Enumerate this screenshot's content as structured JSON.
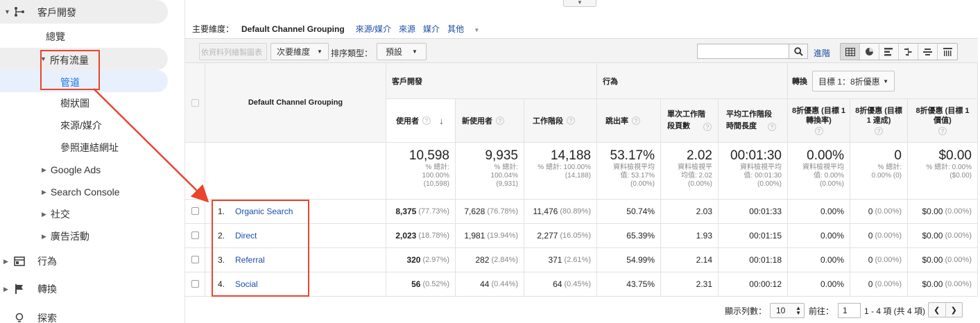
{
  "sidebar": {
    "section_title": "客戶開發",
    "items": [
      {
        "label": "總覽"
      },
      {
        "label": "所有流量"
      },
      {
        "label": "管道"
      },
      {
        "label": "樹狀圖"
      },
      {
        "label": "來源/媒介"
      },
      {
        "label": "參照連結網址"
      },
      {
        "label": "Google Ads"
      },
      {
        "label": "Search Console"
      },
      {
        "label": "社交"
      },
      {
        "label": "廣告活動"
      }
    ],
    "bottom_items": [
      {
        "label": "行為",
        "icon": "behavior-icon"
      },
      {
        "label": "轉換",
        "icon": "flag-icon"
      },
      {
        "label": "探索",
        "icon": "lightbulb-icon"
      }
    ],
    "accent_color": "#1a73e8",
    "selected_bg": "#e8f0fe"
  },
  "dimensions": {
    "label": "主要維度：",
    "active": "Default Channel Grouping",
    "links": [
      "來源/媒介",
      "來源",
      "媒介"
    ],
    "more": "其他"
  },
  "toolbar": {
    "plot_rows": "依資料列繪製圖表",
    "secondary_dim": "次要維度",
    "sort_label": "排序類型：",
    "sort_value": "預設",
    "search_value": "",
    "advanced": "進階"
  },
  "table": {
    "dim_header": "Default Channel Grouping",
    "groups": {
      "acquisition": "客戶開發",
      "behavior": "行為",
      "conversion": "轉換",
      "goal_select": "目標 1：8折優惠"
    },
    "columns": [
      "使用者",
      "新使用者",
      "工作階段",
      "跳出率",
      "單次工作階段頁數",
      "平均工作階段時間長度",
      "8折優惠 (目標 1 轉換率)",
      "8折優惠 (目標 1 達成)",
      "8折優惠 (目標 1 價值)"
    ],
    "totals": [
      {
        "big": "10,598",
        "sub": [
          "% 總計:",
          "100.00%",
          "(10,598)"
        ]
      },
      {
        "big": "9,935",
        "sub": [
          "% 總計:",
          "100.04%",
          "(9,931)"
        ]
      },
      {
        "big": "14,188",
        "sub": [
          "% 總計: 100.00%",
          "(14,188)"
        ]
      },
      {
        "big": "53.17%",
        "sub": [
          "資料檢視平均",
          "值: 53.17%",
          "(0.00%)"
        ]
      },
      {
        "big": "2.02",
        "sub": [
          "資料檢視平",
          "均值: 2.02",
          "(0.00%)"
        ]
      },
      {
        "big": "00:01:30",
        "sub": [
          "資料檢視平均",
          "值: 00:01:30",
          "(0.00%)"
        ]
      },
      {
        "big": "0.00%",
        "sub": [
          "資料檢視平均",
          "值: 0.00%",
          "(0.00%)"
        ]
      },
      {
        "big": "0",
        "sub": [
          "% 總計:",
          "0.00% (0)"
        ]
      },
      {
        "big": "$0.00",
        "sub": [
          "% 總計: 0.00%",
          "($0.00)"
        ]
      }
    ],
    "rows": [
      {
        "num": "1.",
        "name": "Organic Search",
        "users": "8,375",
        "users_pct": "(77.73%)",
        "new_users": "7,628",
        "new_users_pct": "(76.78%)",
        "sessions": "11,476",
        "sessions_pct": "(80.89%)",
        "bounce": "50.74%",
        "pages": "2.03",
        "duration": "00:01:33",
        "conv_rate": "0.00%",
        "completions": "0",
        "completions_pct": "(0.00%)",
        "value": "$0.00",
        "value_pct": "(0.00%)"
      },
      {
        "num": "2.",
        "name": "Direct",
        "users": "2,023",
        "users_pct": "(18.78%)",
        "new_users": "1,981",
        "new_users_pct": "(19.94%)",
        "sessions": "2,277",
        "sessions_pct": "(16.05%)",
        "bounce": "65.39%",
        "pages": "1.93",
        "duration": "00:01:15",
        "conv_rate": "0.00%",
        "completions": "0",
        "completions_pct": "(0.00%)",
        "value": "$0.00",
        "value_pct": "(0.00%)"
      },
      {
        "num": "3.",
        "name": "Referral",
        "users": "320",
        "users_pct": "(2.97%)",
        "new_users": "282",
        "new_users_pct": "(2.84%)",
        "sessions": "371",
        "sessions_pct": "(2.61%)",
        "bounce": "54.99%",
        "pages": "2.14",
        "duration": "00:01:18",
        "conv_rate": "0.00%",
        "completions": "0",
        "completions_pct": "(0.00%)",
        "value": "$0.00",
        "value_pct": "(0.00%)"
      },
      {
        "num": "4.",
        "name": "Social",
        "users": "56",
        "users_pct": "(0.52%)",
        "new_users": "44",
        "new_users_pct": "(0.44%)",
        "sessions": "64",
        "sessions_pct": "(0.45%)",
        "bounce": "43.75%",
        "pages": "2.31",
        "duration": "00:00:12",
        "conv_rate": "0.00%",
        "completions": "0",
        "completions_pct": "(0.00%)",
        "value": "$0.00",
        "value_pct": "(0.00%)"
      }
    ]
  },
  "footer": {
    "rows_label": "顯示列數：",
    "rows_value": "10",
    "goto_label": "前往：",
    "page_value": "1",
    "range": "1 - 4 項 (共 4 項)"
  },
  "annotation_color": "#e8452c"
}
